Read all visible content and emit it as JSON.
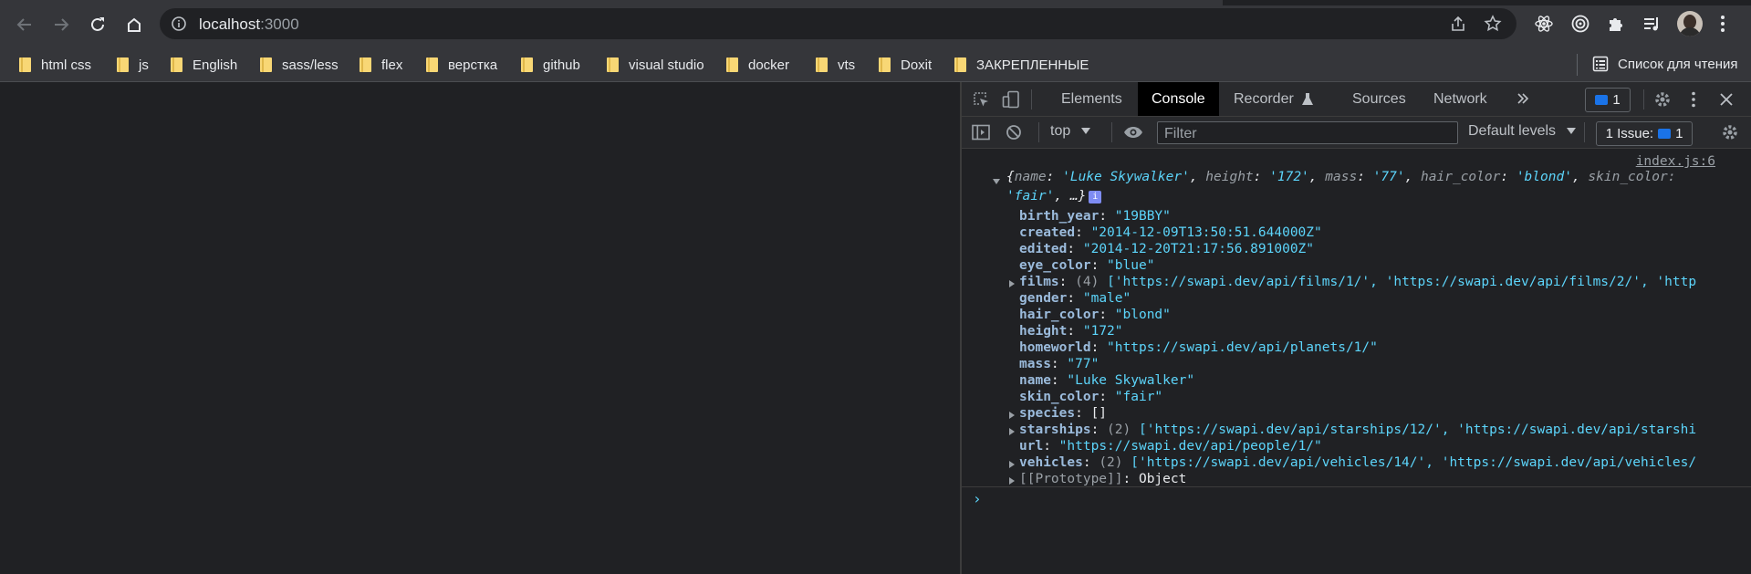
{
  "browser": {
    "url_host": "localhost",
    "url_port": ":3000"
  },
  "bookmarks": [
    {
      "label": "html css"
    },
    {
      "label": "js"
    },
    {
      "label": "English"
    },
    {
      "label": "sass/less"
    },
    {
      "label": "flex"
    },
    {
      "label": "верстка"
    },
    {
      "label": "github"
    },
    {
      "label": "visual studio"
    },
    {
      "label": "docker"
    },
    {
      "label": "vts"
    },
    {
      "label": "Doxit"
    },
    {
      "label": "ЗАКРЕПЛЕННЫЕ"
    }
  ],
  "reading_list": "Список для чтения",
  "devtools": {
    "tabs": [
      "Elements",
      "Console",
      "Recorder",
      "Sources",
      "Network"
    ],
    "active_tab": "Console",
    "message_count": "1",
    "context": "top",
    "filter_placeholder": "Filter",
    "levels": "Default levels",
    "issues_label": "1 Issue:",
    "issues_count": "1"
  },
  "console": {
    "source": "index.js:6",
    "summary": {
      "name": "'Luke Skywalker'",
      "height": "'172'",
      "mass": "'77'",
      "hair_color": "'blond'",
      "skin_color_line1": "skin_color:",
      "skin_color_value": "'fair'",
      "rest": ", …}"
    },
    "props": [
      {
        "key": "birth_year",
        "value": "\"19BBY\""
      },
      {
        "key": "created",
        "value": "\"2014-12-09T13:50:51.644000Z\""
      },
      {
        "key": "edited",
        "value": "\"2014-12-20T21:17:56.891000Z\""
      },
      {
        "key": "eye_color",
        "value": "\"blue\""
      },
      {
        "key": "films",
        "count": "(4)",
        "value": "['https://swapi.dev/api/films/1/', 'https://swapi.dev/api/films/2/', 'http"
      },
      {
        "key": "gender",
        "value": "\"male\""
      },
      {
        "key": "hair_color",
        "value": "\"blond\""
      },
      {
        "key": "height",
        "value": "\"172\""
      },
      {
        "key": "homeworld",
        "value": "\"https://swapi.dev/api/planets/1/\""
      },
      {
        "key": "mass",
        "value": "\"77\""
      },
      {
        "key": "name",
        "value": "\"Luke Skywalker\""
      },
      {
        "key": "skin_color",
        "value": "\"fair\""
      },
      {
        "key": "species",
        "value": "[]"
      },
      {
        "key": "starships",
        "count": "(2)",
        "value": "['https://swapi.dev/api/starships/12/', 'https://swapi.dev/api/starshi"
      },
      {
        "key": "url",
        "value": "\"https://swapi.dev/api/people/1/\""
      },
      {
        "key": "vehicles",
        "count": "(2)",
        "value": "['https://swapi.dev/api/vehicles/14/', 'https://swapi.dev/api/vehicles/"
      },
      {
        "key": "[[Prototype]]",
        "value": "Object"
      }
    ],
    "prompt": "›"
  }
}
